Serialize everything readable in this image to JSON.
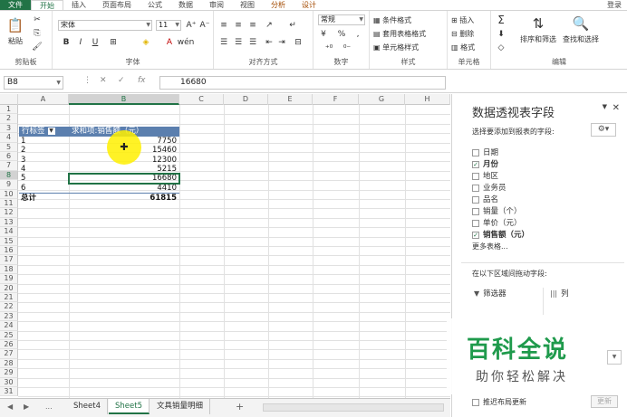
{
  "ribbon_tabs": {
    "file": "文件",
    "home": "开始",
    "insert": "插入",
    "page_layout": "页面布局",
    "formulas": "公式",
    "data": "数据",
    "review": "审阅",
    "view": "视图",
    "analyze": "分析",
    "design": "设计",
    "login": "登录"
  },
  "ribbon": {
    "clipboard": {
      "paste": "粘贴",
      "label": "剪贴板"
    },
    "font": {
      "name": "宋体",
      "size": "11",
      "label": "字体",
      "bold": "B",
      "italic": "I",
      "underline": "U"
    },
    "alignment": {
      "label": "对齐方式"
    },
    "number": {
      "format": "常规",
      "label": "数字",
      "percent": "%"
    },
    "styles": {
      "conditional": "条件格式",
      "table": "套用表格格式",
      "cell": "单元格样式",
      "label": "样式"
    },
    "cells": {
      "insert": "插入",
      "delete": "删除",
      "format": "格式",
      "label": "单元格"
    },
    "editing": {
      "sort": "排序和筛选",
      "find": "查找和选择",
      "label": "编辑"
    }
  },
  "formula_bar": {
    "name_box": "B8",
    "formula": "16680",
    "fx": "fx",
    "cancel": "✕",
    "enter": "✓"
  },
  "columns": [
    "A",
    "B",
    "C",
    "D",
    "E",
    "F",
    "G",
    "H"
  ],
  "rows": [
    "1",
    "2",
    "3",
    "4",
    "5",
    "6",
    "7",
    "8",
    "9",
    "10",
    "11",
    "12",
    "13",
    "14",
    "15",
    "16",
    "17",
    "18",
    "19",
    "20",
    "21",
    "22",
    "23",
    "24",
    "25",
    "26",
    "27",
    "28",
    "29",
    "30",
    "31"
  ],
  "pivot": {
    "row_label": "行标签",
    "value_label": "求和项:销售额（元）",
    "items": [
      {
        "label": "1",
        "value": "7750"
      },
      {
        "label": "2",
        "value": "15460"
      },
      {
        "label": "3",
        "value": "12300"
      },
      {
        "label": "4",
        "value": "5215"
      },
      {
        "label": "5",
        "value": "16680"
      },
      {
        "label": "6",
        "value": "4410"
      }
    ],
    "total_label": "总计",
    "total_value": "61815"
  },
  "sheet_tabs": {
    "sheet4": "Sheet4",
    "sheet5": "Sheet5",
    "sheet_detail": "文具销量明细",
    "more": "...",
    "add": "+"
  },
  "pane": {
    "title": "数据透视表字段",
    "subtitle": "选择要添加到报表的字段:",
    "fields": [
      {
        "label": "日期",
        "checked": false
      },
      {
        "label": "月份",
        "checked": true
      },
      {
        "label": "地区",
        "checked": false
      },
      {
        "label": "业务员",
        "checked": false
      },
      {
        "label": "品名",
        "checked": false
      },
      {
        "label": "销量（个）",
        "checked": false
      },
      {
        "label": "单价（元）",
        "checked": false
      },
      {
        "label": "销售额（元）",
        "checked": true
      }
    ],
    "more_tables": "更多表格...",
    "drag_hint": "在以下区域间拖动字段:",
    "filter_zone": "筛选器",
    "column_zone": "列",
    "defer": "推迟布局更新",
    "update": "更新"
  },
  "watermark": {
    "title": "百科全说",
    "subtitle": "助你轻松解决"
  },
  "colors": {
    "accent": "#217346",
    "pivot_header": "#5b7fae",
    "watermark": "#1f9a4c",
    "cursor": "#fff000"
  }
}
